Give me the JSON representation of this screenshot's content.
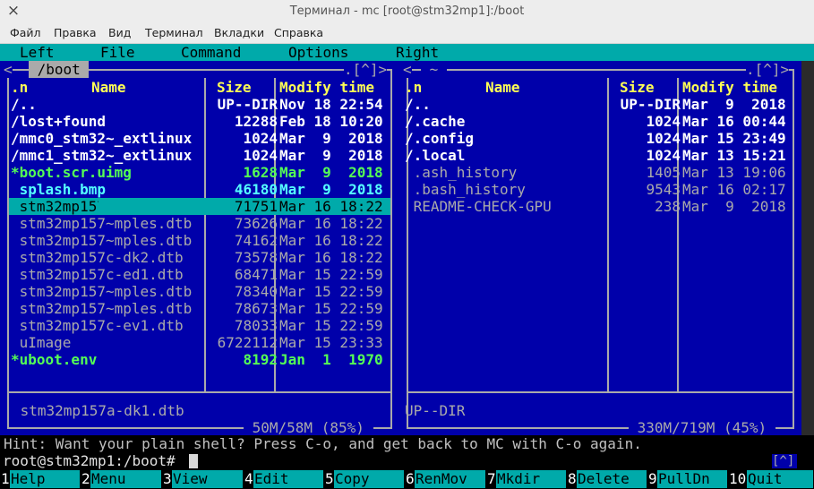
{
  "window": {
    "title": "Терминал - mc [root@stm32mp1]:/boot",
    "close_icon": "×"
  },
  "menubar": [
    "Файл",
    "Правка",
    "Вид",
    "Терминал",
    "Вкладки",
    "Справка"
  ],
  "mc_menu": [
    "Left",
    "File",
    "Command",
    "Options",
    "Right"
  ],
  "left_panel": {
    "path": " /boot ",
    "corner": ".[^]>",
    "corner_left": "<",
    "headers": {
      "n": ".n",
      "name": "Name",
      "size": "Size",
      "time": "Modify time"
    },
    "rows": [
      {
        "name": "/..",
        "size": "UP--DIR",
        "time": "Nov 18 22:54",
        "cls": "white"
      },
      {
        "name": "/lost+found",
        "size": "12288",
        "time": "Feb 18 10:20",
        "cls": "white"
      },
      {
        "name": "/mmc0_stm32~_extlinux",
        "size": "1024",
        "time": "Mar  9  2018",
        "cls": "white"
      },
      {
        "name": "/mmc1_stm32~_extlinux",
        "size": "1024",
        "time": "Mar  9  2018",
        "cls": "white"
      },
      {
        "name": "*boot.scr.uimg",
        "size": "1628",
        "time": "Mar  9  2018",
        "cls": "green"
      },
      {
        "name": " splash.bmp",
        "size": "46180",
        "time": "Mar  9  2018",
        "cls": "cyanb"
      },
      {
        "name": " stm32mp157a-dk1.dtb",
        "size": "71751",
        "time": "Mar 16 18:22",
        "cls": "sel"
      },
      {
        "name": " stm32mp157~mples.dtb",
        "size": "73626",
        "time": "Mar 16 18:22",
        "cls": "grey"
      },
      {
        "name": " stm32mp157~mples.dtb",
        "size": "74162",
        "time": "Mar 16 18:22",
        "cls": "grey"
      },
      {
        "name": " stm32mp157c-dk2.dtb",
        "size": "73578",
        "time": "Mar 16 18:22",
        "cls": "grey"
      },
      {
        "name": " stm32mp157c-ed1.dtb",
        "size": "68471",
        "time": "Mar 15 22:59",
        "cls": "grey"
      },
      {
        "name": " stm32mp157~mples.dtb",
        "size": "78340",
        "time": "Mar 15 22:59",
        "cls": "grey"
      },
      {
        "name": " stm32mp157~mples.dtb",
        "size": "78673",
        "time": "Mar 15 22:59",
        "cls": "grey"
      },
      {
        "name": " stm32mp157c-ev1.dtb",
        "size": "78033",
        "time": "Mar 15 22:59",
        "cls": "grey"
      },
      {
        "name": " uImage",
        "size": "6722112",
        "time": "Mar 15 23:33",
        "cls": "grey"
      },
      {
        "name": "*uboot.env",
        "size": "8192",
        "time": "Jan  1  1970",
        "cls": "green"
      }
    ],
    "mini_status": " stm32mp157a-dk1.dtb",
    "disk": " 50M/58M (85%) "
  },
  "right_panel": {
    "path": " ~ ",
    "corner": ".[^]>",
    "corner_left": "<",
    "headers": {
      "n": ".n",
      "name": "Name",
      "size": "Size",
      "time": "Modify time"
    },
    "rows": [
      {
        "name": "/..",
        "size": "UP--DIR",
        "time": "Mar  9  2018",
        "cls": "white"
      },
      {
        "name": "/.cache",
        "size": "1024",
        "time": "Mar 16 00:44",
        "cls": "white"
      },
      {
        "name": "/.config",
        "size": "1024",
        "time": "Mar 15 23:49",
        "cls": "white"
      },
      {
        "name": "/.local",
        "size": "1024",
        "time": "Mar 13 15:21",
        "cls": "white"
      },
      {
        "name": " .ash_history",
        "size": "1405",
        "time": "Mar 13 19:06",
        "cls": "grey"
      },
      {
        "name": " .bash_history",
        "size": "9543",
        "time": "Mar 16 02:17",
        "cls": "grey"
      },
      {
        "name": " README-CHECK-GPU",
        "size": "238",
        "time": "Mar  9  2018",
        "cls": "grey"
      }
    ],
    "mini_status": "UP--DIR",
    "disk": " 330M/719M (45%) "
  },
  "hint": "Hint: Want your plain shell? Press C-o, and get back to MC with C-o again.",
  "prompt": "root@stm32mp1:/boot#",
  "scroll_hint": "[^]",
  "fkeys": [
    {
      "n": "1",
      "label": "Help"
    },
    {
      "n": "2",
      "label": "Menu"
    },
    {
      "n": "3",
      "label": "View"
    },
    {
      "n": "4",
      "label": "Edit"
    },
    {
      "n": "5",
      "label": "Copy"
    },
    {
      "n": "6",
      "label": "RenMov"
    },
    {
      "n": "7",
      "label": "Mkdir"
    },
    {
      "n": "8",
      "label": "Delete"
    },
    {
      "n": "9",
      "label": "PullDn"
    },
    {
      "n": "10",
      "label": "Quit"
    }
  ]
}
